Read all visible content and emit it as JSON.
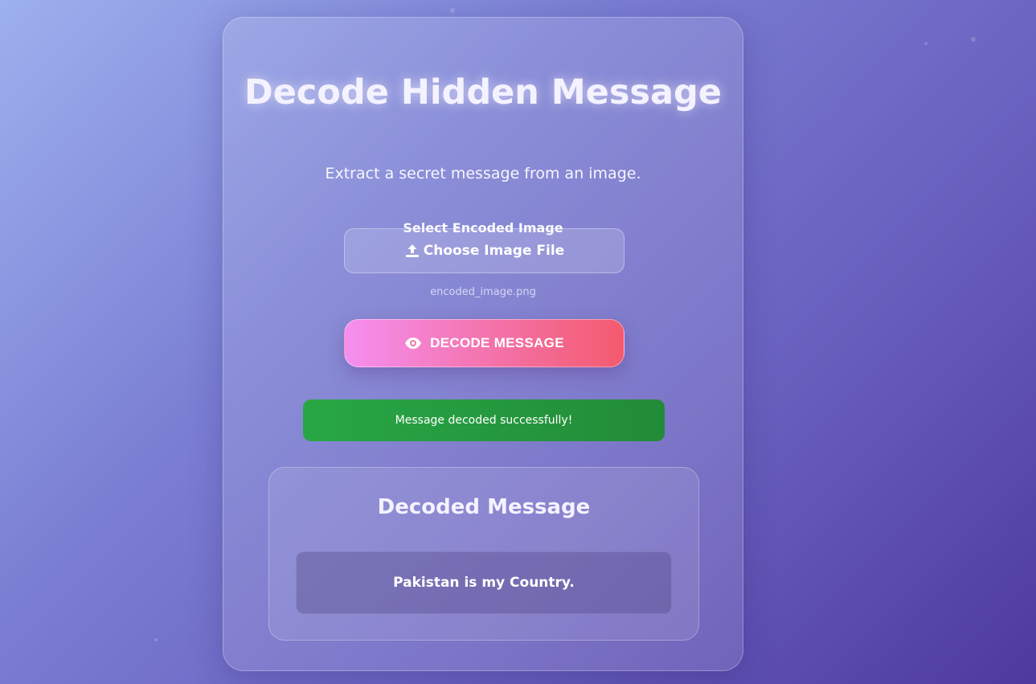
{
  "app": {
    "title": "Decode Hidden Message",
    "subtitle": "Extract a secret message from an image."
  },
  "file_select": {
    "label": "Select Encoded Image",
    "button_label": "Choose Image File",
    "button_icon": "upload-icon",
    "selected_file": "encoded_image.png"
  },
  "decode": {
    "button_label": "DECODE MESSAGE",
    "button_icon": "eye-icon"
  },
  "status": {
    "message": "Message decoded successfully!",
    "color": "#28a745"
  },
  "result": {
    "title": "Decoded Message",
    "message": "Pakistan is my Country."
  },
  "colors": {
    "accent_start": "#f58ff0",
    "accent_end": "#f45a6e",
    "background_start": "#9db0ee",
    "background_end": "#4e3a9f"
  }
}
